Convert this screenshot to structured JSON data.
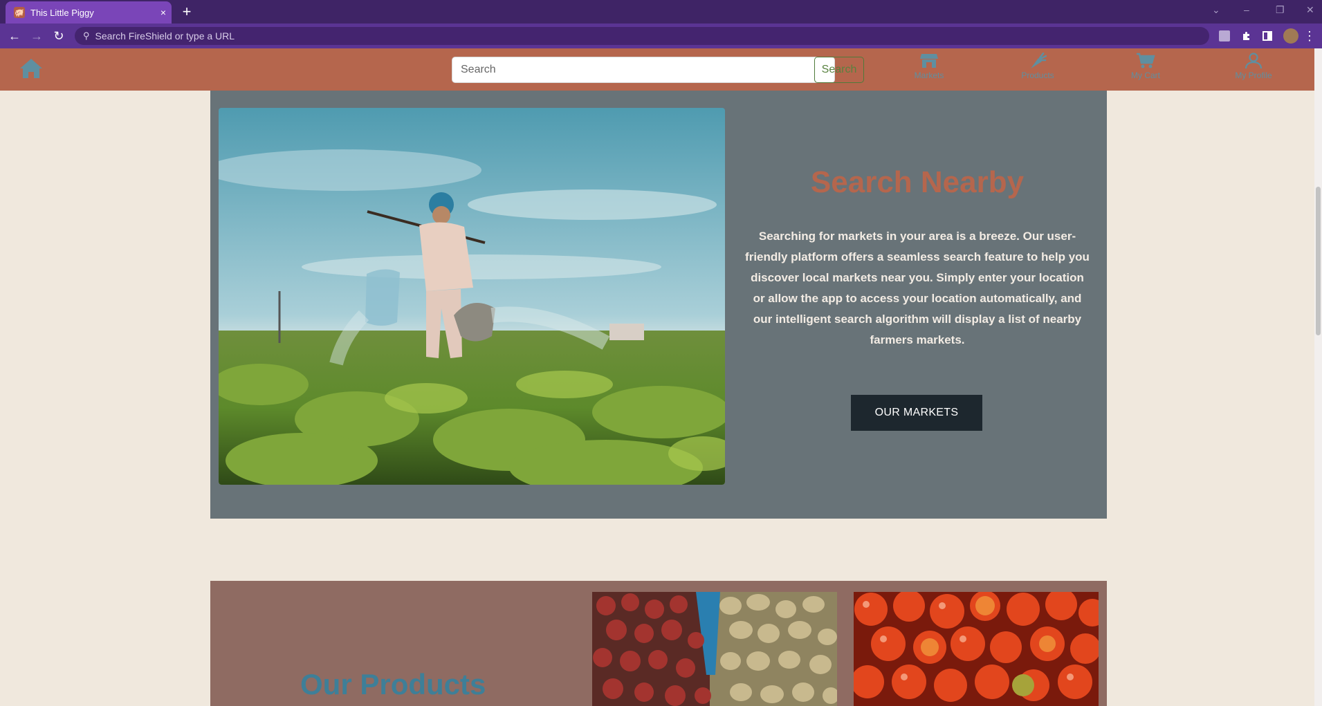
{
  "browser": {
    "tab_title": "This Little Piggy",
    "tab_close": "×",
    "new_tab": "+",
    "address_placeholder": "Search FireShield or type a URL"
  },
  "nav": {
    "search_placeholder": "Search",
    "search_button": "Search",
    "items": [
      {
        "label": "Markets",
        "icon": "store-icon"
      },
      {
        "label": "Products",
        "icon": "carrot-icon"
      },
      {
        "label": "My Cart",
        "icon": "cart-icon"
      },
      {
        "label": "My Profile",
        "icon": "user-icon"
      }
    ]
  },
  "hero": {
    "title": "Search Nearby",
    "text": "Searching for markets in your area is a breeze. Our user-friendly platform offers a seamless search feature to help you discover local markets near you. Simply enter your location or allow the app to access your location automatically, and our intelligent search algorithm will display a list of nearby farmers markets.",
    "button": "OUR MARKETS"
  },
  "products": {
    "title": "Our Products"
  },
  "colors": {
    "nav_bg": "#b5664d",
    "page_bg": "#f0e8dd",
    "hero_panel": "#687378",
    "products_panel": "#8f6b62",
    "accent_blue": "#5f8fa0",
    "title_orange": "#b5664d"
  }
}
